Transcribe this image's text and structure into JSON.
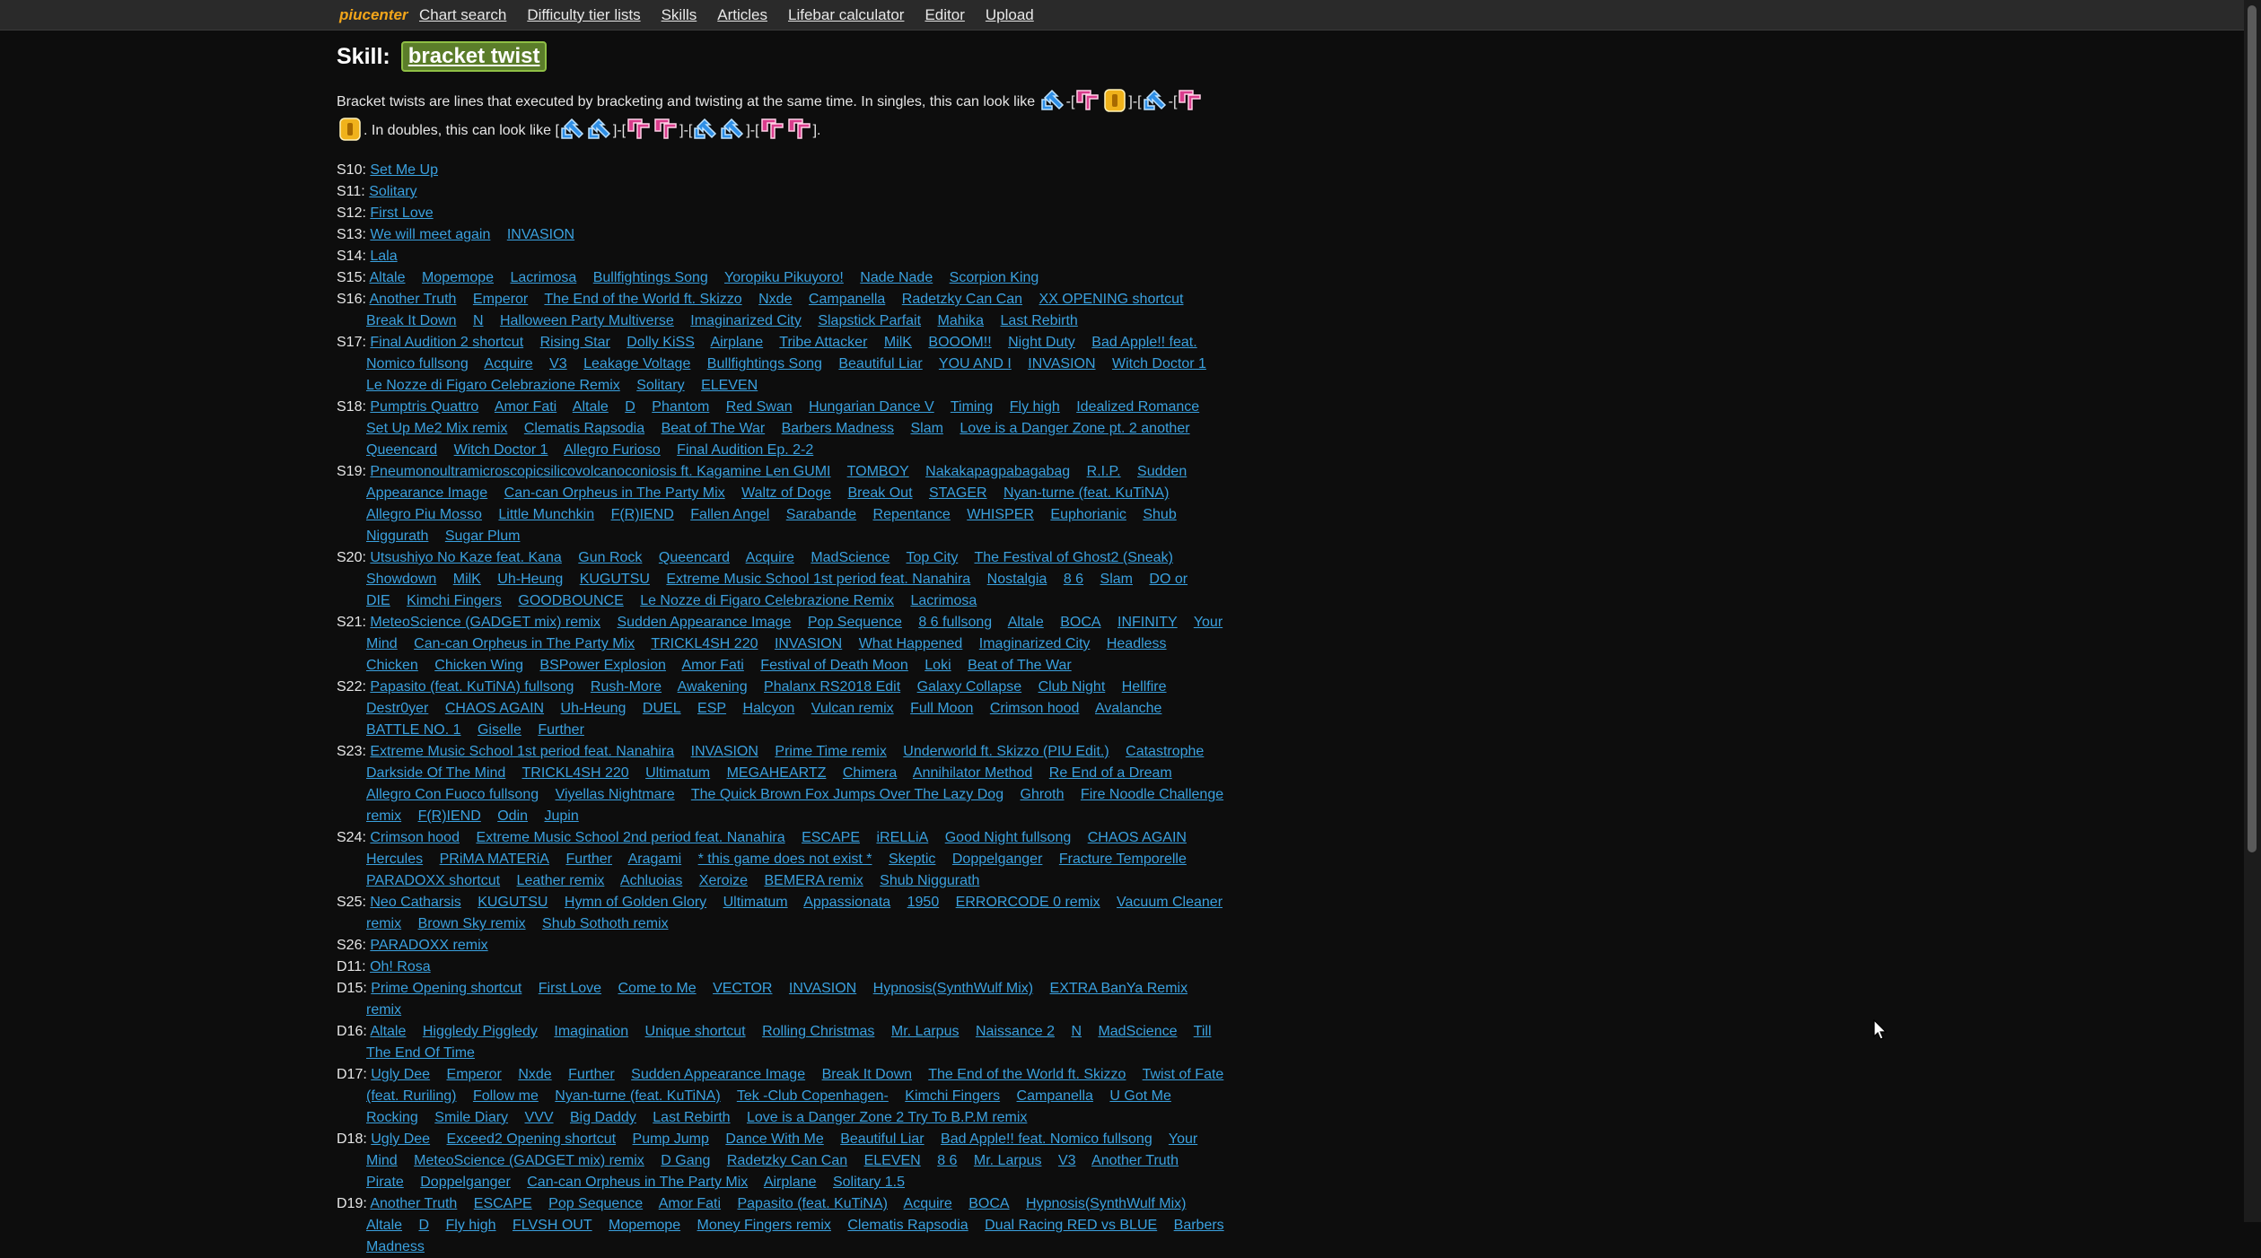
{
  "topbar": {
    "brand": "piucenter",
    "nav": [
      "Chart search",
      "Difficulty tier lists",
      "Skills",
      "Articles",
      "Lifebar calculator",
      "Editor",
      "Upload"
    ]
  },
  "page": {
    "label": "Skill:",
    "skill": "bracket twist",
    "intro_1": "Bracket twists are lines that executed by bracketing and twisting at the same time. In singles, this can look like ",
    "intro_2": ". In doubles, this can look like [",
    "intro_end": "].",
    "sep_dash": "-[",
    "sep_close_dash": "]-[",
    "sep_dash2": "]-"
  },
  "colors": {
    "link": "#3aa1df",
    "brand": "#f2a51a",
    "skill_bg": "#5b7d2a",
    "arrow_blue": "#2f8fe6",
    "arrow_pink": "#d93c8c",
    "arrow_yellow": "#f0b21b"
  },
  "icons": [
    "arrow-down-left-icon",
    "arrow-up-left-icon",
    "arrow-center-icon",
    "cursor-icon"
  ],
  "rows": [
    {
      "level": "S10:",
      "songs": [
        "Set Me Up"
      ]
    },
    {
      "level": "S11:",
      "songs": [
        "Solitary"
      ]
    },
    {
      "level": "S12:",
      "songs": [
        "First Love"
      ]
    },
    {
      "level": "S13:",
      "songs": [
        "We will meet again",
        "INVASION"
      ]
    },
    {
      "level": "S14:",
      "songs": [
        "Lala"
      ]
    },
    {
      "level": "S15:",
      "songs": [
        "Altale",
        "Mopemope",
        "Lacrimosa",
        "Bullfightings Song",
        "Yoropiku Pikuyoro!",
        "Nade Nade",
        "Scorpion King"
      ]
    },
    {
      "level": "S16:",
      "songs": [
        "Another Truth",
        "Emperor",
        "The End of the World ft. Skizzo",
        "Nxde",
        "Campanella",
        "Radetzky Can Can",
        "XX OPENING shortcut",
        "Break It Down",
        "N",
        "Halloween Party Multiverse",
        "Imaginarized City",
        "Slapstick Parfait",
        "Mahika",
        "Last Rebirth"
      ]
    },
    {
      "level": "S17:",
      "songs": [
        "Final Audition 2 shortcut",
        "Rising Star",
        "Dolly KiSS",
        "Airplane",
        "Tribe Attacker",
        "MilK",
        "BOOOM!!",
        "Night Duty",
        "Bad Apple!! feat. Nomico fullsong",
        "Acquire",
        "V3",
        "Leakage Voltage",
        "Bullfightings Song",
        "Beautiful Liar",
        "YOU AND I",
        "INVASION",
        "Witch Doctor 1",
        "Le Nozze di Figaro Celebrazione Remix",
        "Solitary",
        "ELEVEN"
      ]
    },
    {
      "level": "S18:",
      "songs": [
        "Pumptris Quattro",
        "Amor Fati",
        "Altale",
        "D",
        "Phantom",
        "Red Swan",
        "Hungarian Dance V",
        "Timing",
        "Fly high",
        "Idealized Romance",
        "Set Up Me2 Mix remix",
        "Clematis Rapsodia",
        "Beat of The War",
        "Barbers Madness",
        "Slam",
        "Love is a Danger Zone pt. 2 another",
        "Queencard",
        "Witch Doctor 1",
        "Allegro Furioso",
        "Final Audition Ep. 2-2"
      ]
    },
    {
      "level": "S19:",
      "songs": [
        "Pneumonoultramicroscopicsilicovolcanoconiosis ft. Kagamine Len GUMI",
        "TOMBOY",
        "Nakakapagpabagabag",
        "R.I.P.",
        "Sudden Appearance Image",
        "Can-can Orpheus in The Party Mix",
        "Waltz of Doge",
        "Break Out",
        "STAGER",
        "Nyan-turne (feat. KuTiNA)",
        "Allegro Piu Mosso",
        "Little Munchkin",
        "F(R)IEND",
        "Fallen Angel",
        "Sarabande",
        "Repentance",
        "WHISPER",
        "Euphorianic",
        "Shub Niggurath",
        "Sugar Plum"
      ]
    },
    {
      "level": "S20:",
      "songs": [
        "Utsushiyo No Kaze feat. Kana",
        "Gun Rock",
        "Queencard",
        "Acquire",
        "MadScience",
        "Top City",
        "The Festival of Ghost2 (Sneak)",
        "Showdown",
        "MilK",
        "Uh-Heung",
        "KUGUTSU",
        "Extreme Music School 1st period feat. Nanahira",
        "Nostalgia",
        "8 6",
        "Slam",
        "DO or DIE",
        "Kimchi Fingers",
        "GOODBOUNCE",
        "Le Nozze di Figaro Celebrazione Remix",
        "Lacrimosa"
      ]
    },
    {
      "level": "S21:",
      "songs": [
        "MeteoScience (GADGET mix) remix",
        "Sudden Appearance Image",
        "Pop Sequence",
        "8 6 fullsong",
        "Altale",
        "BOCA",
        "INFINITY",
        "Your Mind",
        "Can-can Orpheus in The Party Mix",
        "TRICKL4SH 220",
        "INVASION",
        "What Happened",
        "Imaginarized City",
        "Headless Chicken",
        "Chicken Wing",
        "BSPower Explosion",
        "Amor Fati",
        "Festival of Death Moon",
        "Loki",
        "Beat of The War"
      ]
    },
    {
      "level": "S22:",
      "songs": [
        "Papasito (feat. KuTiNA) fullsong",
        "Rush-More",
        "Awakening",
        "Phalanx RS2018 Edit",
        "Galaxy Collapse",
        "Club Night",
        "Hellfire",
        "Destr0yer",
        "CHAOS AGAIN",
        "Uh-Heung",
        "DUEL",
        "ESP",
        "Halcyon",
        "Vulcan remix",
        "Full Moon",
        "Crimson hood",
        "Avalanche",
        "BATTLE NO. 1",
        "Giselle",
        "Further"
      ]
    },
    {
      "level": "S23:",
      "songs": [
        "Extreme Music School 1st period feat. Nanahira",
        "INVASION",
        "Prime Time remix",
        "Underworld ft. Skizzo (PIU Edit.)",
        "Catastrophe",
        "Darkside Of The Mind",
        "TRICKL4SH 220",
        "Ultimatum",
        "MEGAHEARTZ",
        "Chimera",
        "Annihilator Method",
        "Re End of a Dream",
        "Allegro Con Fuoco fullsong",
        "Viyellas Nightmare",
        "The Quick Brown Fox Jumps Over The Lazy Dog",
        "Ghroth",
        "Fire Noodle Challenge remix",
        "F(R)IEND",
        "Odin",
        "Jupin"
      ]
    },
    {
      "level": "S24:",
      "songs": [
        "Crimson hood",
        "Extreme Music School 2nd period feat. Nanahira",
        "ESCAPE",
        "iRELLiA",
        "Good Night fullsong",
        "CHAOS AGAIN",
        "Hercules",
        "PRiMA MATERiA",
        "Further",
        "Aragami",
        "* this game does not exist *",
        "Skeptic",
        "Doppelganger",
        "Fracture Temporelle",
        "PARADOXX shortcut",
        "Leather remix",
        "Achluoias",
        "Xeroize",
        "BEMERA remix",
        "Shub Niggurath"
      ]
    },
    {
      "level": "S25:",
      "songs": [
        "Neo Catharsis",
        "KUGUTSU",
        "Hymn of Golden Glory",
        "Ultimatum",
        "Appassionata",
        "1950",
        "ERRORCODE 0 remix",
        "Vacuum Cleaner remix",
        "Brown Sky remix",
        "Shub Sothoth remix"
      ]
    },
    {
      "level": "S26:",
      "songs": [
        "PARADOXX remix"
      ]
    },
    {
      "level": "D11:",
      "songs": [
        "Oh! Rosa"
      ]
    },
    {
      "level": "D15:",
      "songs": [
        "Prime Opening shortcut",
        "First Love",
        "Come to Me",
        "VECTOR",
        "INVASION",
        "Hypnosis(SynthWulf Mix)",
        "EXTRA BanYa Remix remix"
      ]
    },
    {
      "level": "D16:",
      "songs": [
        "Altale",
        "Higgledy Piggledy",
        "Imagination",
        "Unique shortcut",
        "Rolling Christmas",
        "Mr. Larpus",
        "Naissance 2",
        "N",
        "MadScience",
        "Till The End Of Time"
      ]
    },
    {
      "level": "D17:",
      "songs": [
        "Ugly Dee",
        "Emperor",
        "Nxde",
        "Further",
        "Sudden Appearance Image",
        "Break It Down",
        "The End of the World ft. Skizzo",
        "Twist of Fate (feat. Ruriling)",
        "Follow me",
        "Nyan-turne (feat. KuTiNA)",
        "Tek -Club Copenhagen-",
        "Kimchi Fingers",
        "Campanella",
        "U Got Me Rocking",
        "Smile Diary",
        "VVV",
        "Big Daddy",
        "Last Rebirth",
        "Love is a Danger Zone 2 Try To B.P.M remix"
      ]
    },
    {
      "level": "D18:",
      "songs": [
        "Ugly Dee",
        "Exceed2 Opening shortcut",
        "Pump Jump",
        "Dance With Me",
        "Beautiful Liar",
        "Bad Apple!! feat. Nomico fullsong",
        "Your Mind",
        "MeteoScience (GADGET mix) remix",
        "D Gang",
        "Radetzky Can Can",
        "ELEVEN",
        "8 6",
        "Mr. Larpus",
        "V3",
        "Another Truth",
        "Pirate",
        "Doppelganger",
        "Can-can Orpheus in The Party Mix",
        "Airplane",
        "Solitary 1.5"
      ]
    },
    {
      "level": "D19:",
      "songs": [
        "Another Truth",
        "ESCAPE",
        "Pop Sequence",
        "Amor Fati",
        "Papasito (feat. KuTiNA)",
        "Acquire",
        "BOCA",
        "Hypnosis(SynthWulf Mix)",
        "Altale",
        "D",
        "Fly high",
        "FLVSH OUT",
        "Mopemope",
        "Money Fingers remix",
        "Clematis Rapsodia",
        "Dual Racing RED vs BLUE",
        "Barbers Madness"
      ]
    }
  ]
}
